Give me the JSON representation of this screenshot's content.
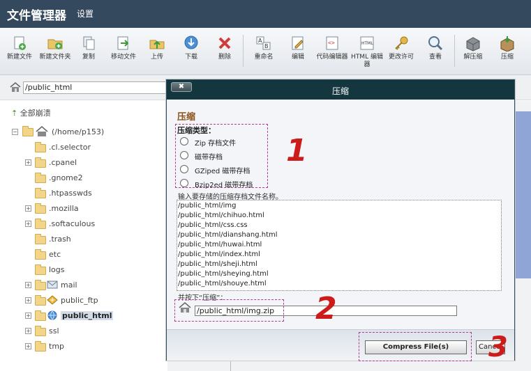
{
  "app": {
    "title": "文件管理器",
    "settings_label": "设置"
  },
  "toolbar": {
    "buttons": [
      {
        "label": "新建文件",
        "icon": "new-file-icon"
      },
      {
        "label": "新建文件夹",
        "icon": "new-folder-icon"
      },
      {
        "label": "复制",
        "icon": "copy-icon"
      },
      {
        "label": "移动文件",
        "icon": "move-file-icon"
      },
      {
        "label": "上传",
        "icon": "upload-icon"
      },
      {
        "label": "下载",
        "icon": "download-icon"
      },
      {
        "label": "删除",
        "icon": "delete-icon"
      },
      {
        "label": "重命名",
        "icon": "rename-icon"
      },
      {
        "label": "编辑",
        "icon": "edit-icon"
      },
      {
        "label": "代码编辑器",
        "icon": "code-editor-icon"
      },
      {
        "label": "HTML 编辑器",
        "icon": "html-editor-icon"
      },
      {
        "label": "更改许可",
        "icon": "permissions-key-icon"
      },
      {
        "label": "查看",
        "icon": "view-magnifier-icon"
      },
      {
        "label": "解压缩",
        "icon": "extract-icon"
      },
      {
        "label": "压缩",
        "icon": "compress-icon"
      }
    ]
  },
  "path": {
    "value": "/public_html"
  },
  "sidebar": {
    "collapse_all": "全部崩溃",
    "root": "(/home/p153)",
    "items": [
      {
        "label": ".cl.selector",
        "expandable": false
      },
      {
        "label": ".cpanel",
        "expandable": true
      },
      {
        "label": ".gnome2",
        "expandable": false
      },
      {
        "label": ".htpasswds",
        "expandable": false
      },
      {
        "label": ".mozilla",
        "expandable": true
      },
      {
        "label": ".softaculous",
        "expandable": true
      },
      {
        "label": ".trash",
        "expandable": false
      },
      {
        "label": "etc",
        "expandable": false
      },
      {
        "label": "logs",
        "expandable": false
      },
      {
        "label": "mail",
        "expandable": true
      },
      {
        "label": "public_ftp",
        "expandable": true
      },
      {
        "label": "public_html",
        "expandable": true
      },
      {
        "label": "ssl",
        "expandable": true
      },
      {
        "label": "tmp",
        "expandable": true
      }
    ]
  },
  "dialog": {
    "title": "压缩",
    "close_label": "✖",
    "section_title": "压缩",
    "type_label": "压缩类型：",
    "options": [
      "Zip 存档文件",
      "磁带存档",
      "GZiped 磁带存档",
      "Bzip2ed 磁带存档"
    ],
    "prompt": "输入要存储的压缩存档文件名称。",
    "files": [
      "/public_html/img",
      "/public_html/chihuo.html",
      "/public_html/css.css",
      "/public_html/dianshang.html",
      "/public_html/huwai.html",
      "/public_html/index.html",
      "/public_html/sheji.html",
      "/public_html/sheying.html",
      "/public_html/shouye.html"
    ],
    "confirm_text": "并按下“压缩”：",
    "archive_name": "/public_html/img.zip",
    "compress_label": "Compress File(s)",
    "cancel_label": "Cancel"
  },
  "annotations": {
    "step1": "1",
    "step2": "2",
    "step3": "3"
  },
  "colors": {
    "topbar": "#34495e",
    "dialog_header": "#14363e",
    "annotation_red": "#cc1b1b",
    "annotation_dash": "#b23a95"
  }
}
